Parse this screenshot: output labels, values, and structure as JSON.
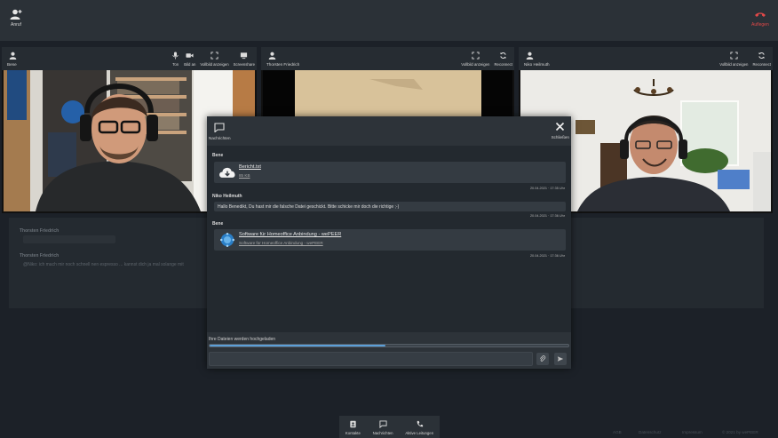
{
  "topbar": {
    "call_label": "Anruf",
    "hangup_label": "Auflegen"
  },
  "tiles": [
    {
      "name": "Bene",
      "controls": [
        "Ton",
        "Bild an",
        "Vollbild anzeigen",
        "Screenshare"
      ]
    },
    {
      "name": "Thorsten Friedrich",
      "controls": [
        "Vollbild anzeigen",
        "Reconnect"
      ]
    },
    {
      "name": "Niko Heilmuth",
      "controls": [
        "Vollbild anzeigen",
        "Reconnect"
      ]
    }
  ],
  "background_chat": {
    "msg1_sender": "Thorsten Friedrich",
    "msg2_sender": "Thorsten Friedrich",
    "msg2_text": "@Niko: ich mach mir noch schnell nen espresso ... kannst dich ja mal solange mit"
  },
  "chat": {
    "title": "Nachrichten",
    "close_label": "Schließen",
    "messages": [
      {
        "sender": "Bene",
        "file_name": "Bericht.txt",
        "file_size": "85 KB",
        "timestamp": "20.04.2021 · 17:35 Uhr"
      },
      {
        "sender": "Niko Heilmuth",
        "text": "Hallo Benedikt, Du hast mir die falsche Datei geschickt. Bitte schicke mir doch die richtige ;-)",
        "timestamp": "20.04.2021 · 17:36 Uhr"
      },
      {
        "sender": "Bene",
        "link_title": "Software für Homeoffice Anbindung - wePEER",
        "link_sub": "Software für Homeoffice Anbindung - wePEER",
        "timestamp": "20.04.2021 · 17:36 Uhr"
      }
    ],
    "upload_status": "Ihre Dateien werden hochgeladen",
    "upload_progress": 0.49,
    "composer_placeholder": ""
  },
  "bottombar": {
    "items": [
      "Kontakte",
      "Nachrichten",
      "Aktive Leitungen"
    ]
  },
  "footer": {
    "agb": "AGB",
    "datenschutz": "Datenschutz",
    "impressum": "Impressum",
    "copyright": "© 2021 by wePEER"
  },
  "colors": {
    "hangup": "#e04848",
    "progress": "#5b9fd8",
    "background": "#1c2128"
  }
}
